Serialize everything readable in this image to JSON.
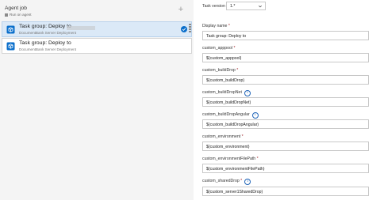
{
  "agent_job": {
    "title": "Agent job",
    "subtitle": "Run on agent"
  },
  "tasks": [
    {
      "name": "Task group: Deploy to",
      "subtitle": "DocumentBank Server Deployment",
      "selected": true
    },
    {
      "name": "Task group: Deploy to",
      "subtitle": "DocumentBank Server Deployment",
      "selected": false
    }
  ],
  "task_version": {
    "label": "Task version",
    "value": "1.*"
  },
  "fields": [
    {
      "label": "Display name",
      "required": "*",
      "info": "",
      "value": "Task group: Deploy to"
    },
    {
      "label": "custom_apppool",
      "required": "*",
      "info": "",
      "value": "$(custom_apppool)"
    },
    {
      "label": "custom_buildDrop",
      "required": "*",
      "info": "",
      "value": "$(custom_buildDrop)"
    },
    {
      "label": "custom_buildDropNet",
      "required": "",
      "info": "i",
      "value": "$(custom_buildDropNet)"
    },
    {
      "label": "custom_buildDropAngular",
      "required": "",
      "info": "i",
      "value": "$(custom_buildDropAngular)"
    },
    {
      "label": "custom_environment",
      "required": "*",
      "info": "",
      "value": "$(custom_environment)"
    },
    {
      "label": "custom_environmentFilePath",
      "required": "*",
      "info": "",
      "value": "$(custom_environmentFilePath)"
    },
    {
      "label": "custom_sharedDrop",
      "required": "*",
      "info": "i",
      "value": "$(custom_server1SharedDrop)"
    }
  ],
  "icons": {
    "task": "task-group-icon",
    "check": "check-circle-icon",
    "grip": "drag-handle-icon",
    "add": "plus-icon",
    "chevron": "chevron-down-icon",
    "info": "info-icon"
  },
  "colors": {
    "accent": "#0b6fcb",
    "selected_bg": "#dbe9f7",
    "required": "#a4262c"
  }
}
